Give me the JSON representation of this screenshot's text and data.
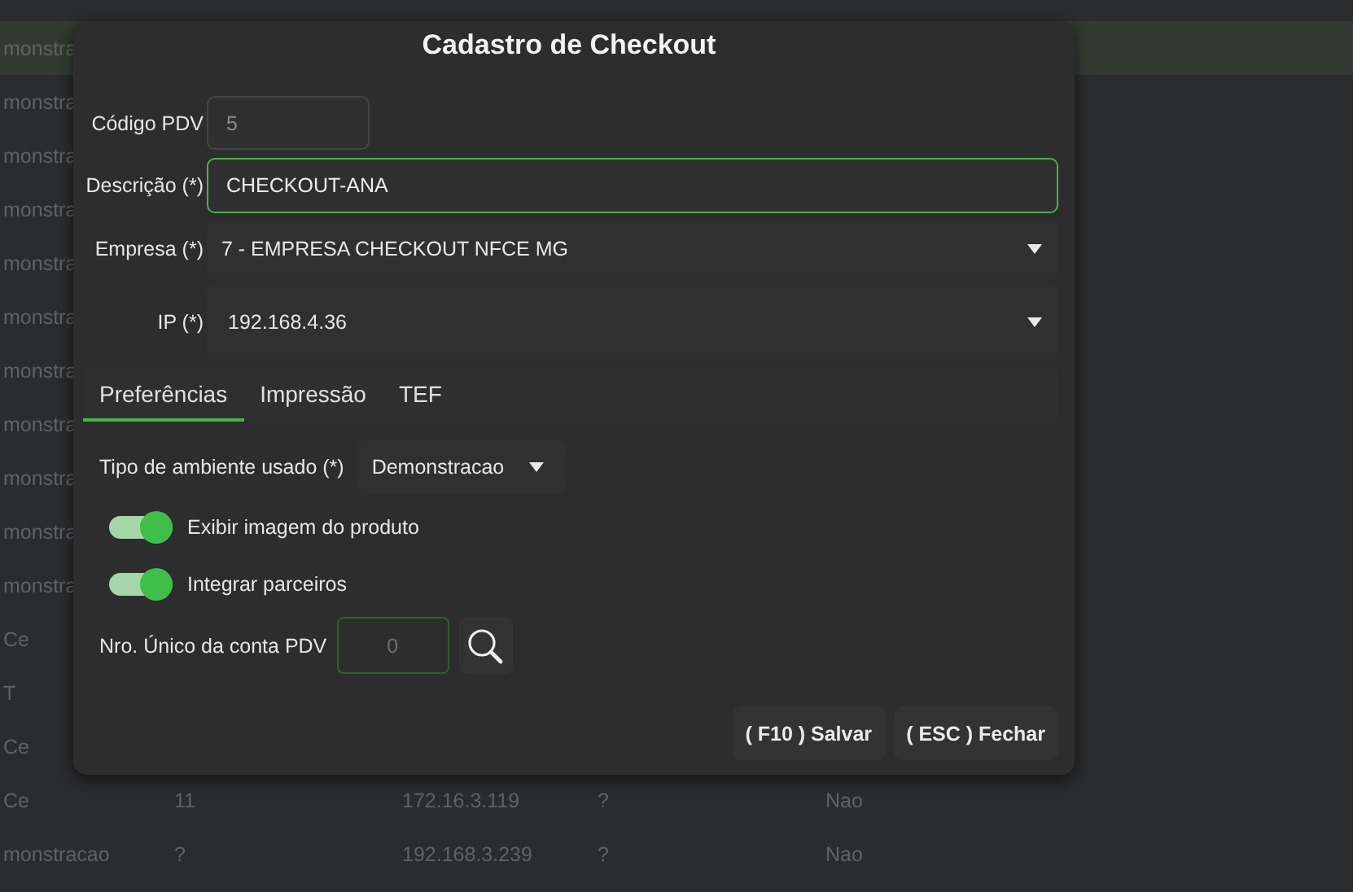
{
  "background_table": {
    "rows": [
      {
        "column_1": "monstra",
        "selected": true
      },
      {
        "column_1": "monstra",
        "selected": false
      },
      {
        "column_1": "monstra",
        "selected": false
      },
      {
        "column_1": "monstra",
        "selected": false
      },
      {
        "column_1": "monstra",
        "selected": false
      },
      {
        "column_1": "monstra",
        "selected": false
      },
      {
        "column_1": "monstra",
        "selected": false
      },
      {
        "column_1": "monstra",
        "selected": false
      },
      {
        "column_1": "monstra",
        "selected": false
      },
      {
        "column_1": "monstra",
        "selected": false
      },
      {
        "column_1": "monstra",
        "selected": false
      },
      {
        "column_1": "Ce",
        "selected": false
      },
      {
        "column_1": "T",
        "selected": false
      },
      {
        "column_1": "Ce",
        "selected": false
      },
      {
        "column_1": "Ce",
        "column_2": "11",
        "column_3": "172.16.3.119",
        "column_4": "?",
        "column_5": "Nao",
        "selected": false
      },
      {
        "column_1": "monstracao",
        "column_2": "?",
        "column_3": "192.168.3.239",
        "column_4": "?",
        "column_5": "Nao",
        "selected": false
      }
    ]
  },
  "dialog": {
    "title": "Cadastro de Checkout",
    "fields": [
      {
        "kind": "text",
        "label": "Código PDV",
        "value": "5",
        "disabled": true,
        "focused": false
      },
      {
        "kind": "text",
        "label": "Descrição (*)",
        "value": "CHECKOUT-ANA",
        "disabled": false,
        "focused": true
      },
      {
        "kind": "select",
        "label": "Empresa (*)",
        "value": "7 - EMPRESA CHECKOUT NFCE MG"
      },
      {
        "kind": "select",
        "label": "IP (*)",
        "value": "192.168.4.36"
      }
    ],
    "tabs": [
      {
        "label": "Preferências",
        "selected": true
      },
      {
        "label": "Impressão",
        "selected": false
      },
      {
        "label": "TEF",
        "selected": false
      }
    ],
    "preferences": {
      "environment": {
        "label": "Tipo de ambiente usado (*)",
        "value": "Demonstracao"
      },
      "toggles": [
        {
          "label": "Exibir imagem do produto",
          "on": true
        },
        {
          "label": "Integrar parceiros",
          "on": true
        }
      ],
      "account": {
        "label": "Nro. Único da conta PDV",
        "placeholder": "0"
      }
    },
    "buttons": [
      "( F10 ) Salvar",
      "( ESC ) Fechar"
    ]
  }
}
